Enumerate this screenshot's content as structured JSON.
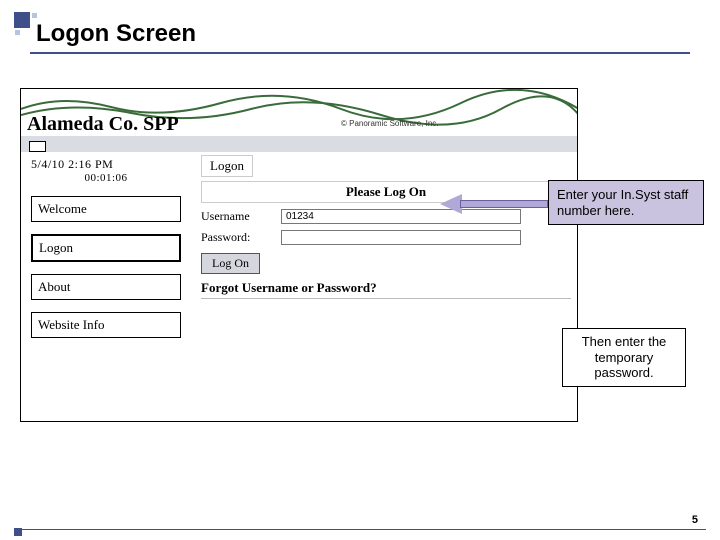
{
  "slide": {
    "title": "Logon Screen",
    "page_number": "5"
  },
  "app": {
    "brand": "Alameda Co. SPP",
    "subtext": "© Panoramic Software, Inc.",
    "datetime": "5/4/10 2:16 PM",
    "elapsed": "00:01:06",
    "nav": {
      "welcome": "Welcome",
      "logon": "Logon",
      "about": "About",
      "website_info": "Website Info"
    },
    "panel": {
      "heading": "Logon",
      "instruction": "Please Log On",
      "username_label": "Username",
      "username_value": "01234",
      "password_label": "Password:",
      "password_value": "",
      "button": "Log On",
      "forgot": "Forgot Username or Password?"
    }
  },
  "callouts": {
    "username_hint": "Enter your In.Syst staff number here.",
    "password_hint": "Then enter the temporary password."
  }
}
